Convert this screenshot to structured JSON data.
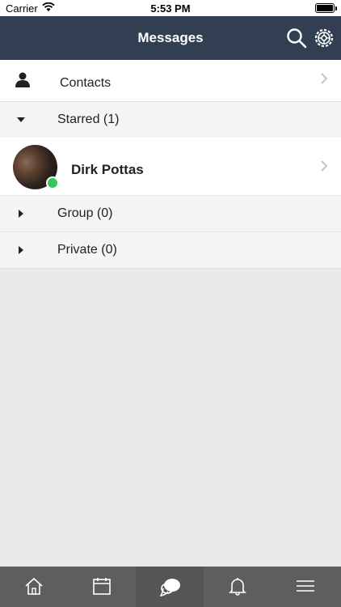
{
  "status_bar": {
    "carrier": "Carrier",
    "time": "5:53 PM"
  },
  "nav": {
    "title": "Messages"
  },
  "contacts": {
    "label": "Contacts"
  },
  "sections": [
    {
      "label": "Starred (1)",
      "expanded": true
    },
    {
      "label": "Group (0)",
      "expanded": false
    },
    {
      "label": "Private (0)",
      "expanded": false
    }
  ],
  "starred_items": [
    {
      "name": "Dirk Pottas",
      "status": "online"
    }
  ],
  "tabbar": {
    "items": [
      {
        "icon": "home-icon"
      },
      {
        "icon": "calendar-icon"
      },
      {
        "icon": "chat-bubble-icon",
        "active": true
      },
      {
        "icon": "bell-icon"
      },
      {
        "icon": "menu-icon"
      }
    ]
  },
  "colors": {
    "nav": "#323f53",
    "tabbar": "#5e5e5e",
    "online": "#34c759"
  }
}
